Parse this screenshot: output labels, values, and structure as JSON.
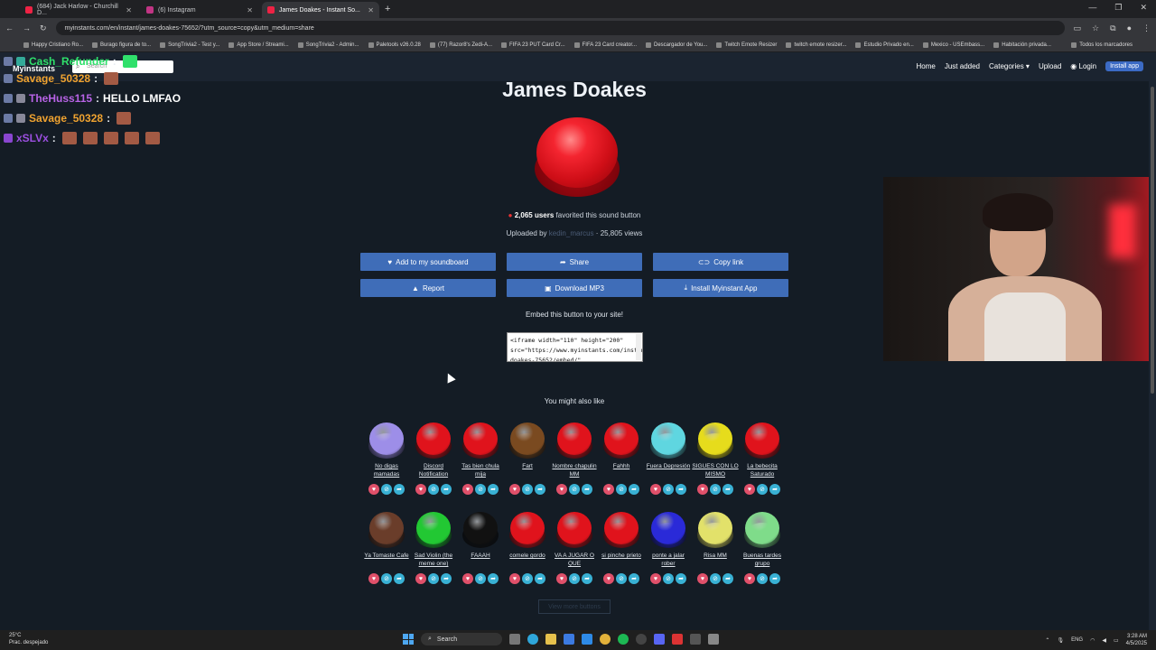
{
  "browser": {
    "tabs": [
      {
        "label": "(684) Jack Harlow - Churchill D...",
        "active": false
      },
      {
        "label": "(6) Instagram",
        "active": false
      },
      {
        "label": "James Doakes - Instant So...",
        "active": true
      }
    ],
    "url": "myinstants.com/en/instant/james-doakes-75652/?utm_source=copy&utm_medium=share",
    "bookmarks": [
      "Happy Cristiano Ro...",
      "Burago figura de to...",
      "SongTrivia2 - Test y...",
      "App Store / Streami...",
      "SongTrivia2 - Admin...",
      "Paletools v26.0.28",
      "(77) Razor8's Zedi-A...",
      "FIFA 23 PUT Card Cr...",
      "FIFA 23 Card creator...",
      "Descargador de You...",
      "Twitch Emote Resizer",
      "twitch emote resizer...",
      "Estudio Privado en...",
      "Mexico - USEmbass...",
      "Habitación privada..."
    ],
    "all_bookmarks": "Todos los marcadores"
  },
  "site": {
    "logo": "Myinstants",
    "search_placeholder": "Search",
    "nav": [
      "Home",
      "Just added",
      "Categories ▾",
      "Upload",
      "Login"
    ],
    "install_app": "Install app"
  },
  "chat": [
    {
      "user": "Cash_Refunder",
      "color": "#2fe06b",
      "message": ""
    },
    {
      "user": "Savage_50328",
      "color": "#f0a330",
      "message": ""
    },
    {
      "user": "TheHuss115",
      "color": "#b863e6",
      "message": "HELLO LMFAO"
    },
    {
      "user": "Savage_50328",
      "color": "#f0a330",
      "message": ""
    },
    {
      "user": "xSLVx",
      "color": "#9b4fe0",
      "message": ""
    }
  ],
  "sound": {
    "title": "James Doakes",
    "favorited_count": "2,065 users",
    "favorited_text": "favorited this sound button",
    "uploaded_by_label": "Uploaded by",
    "uploader": "kedin_marcus",
    "views": "25,805 views",
    "actions": {
      "add": "Add to my soundboard",
      "share": "Share",
      "copy": "Copy link",
      "report": "Report",
      "download": "Download MP3",
      "install": "Install Myinstant App"
    },
    "embed_label": "Embed this button to your site!",
    "embed_code": "<iframe width=\"110\" height=\"200\" src=\"https://www.myinstants.com/instant/james-doakes-75652/embed/\""
  },
  "suggestions_title": "You might also like",
  "suggestions": [
    {
      "label": "No digas mamadas",
      "color": "#9d8ee8"
    },
    {
      "label": "Discord Notification",
      "color": "#e0131c"
    },
    {
      "label": "Tas bien chula mija",
      "color": "#e0131c"
    },
    {
      "label": "Fart",
      "color": "#7a4a20"
    },
    {
      "label": "Nombre chapulin MM",
      "color": "#e0131c"
    },
    {
      "label": "Fahhh",
      "color": "#e0131c"
    },
    {
      "label": "Fuera Depresión",
      "color": "#5fd6e0"
    },
    {
      "label": "SIGUES CON LO MISMO",
      "color": "#e6dc1c"
    },
    {
      "label": "La bebecita Saturado",
      "color": "#e0131c"
    },
    {
      "label": "Ya Tomaste Cafe",
      "color": "#6a3d2a"
    },
    {
      "label": "Sad Violin (the meme one)",
      "color": "#22c833"
    },
    {
      "label": "FAAAH",
      "color": "#111111"
    },
    {
      "label": "comele gordo",
      "color": "#e0131c"
    },
    {
      "label": "VA A JUGAR O QUE",
      "color": "#e0131c"
    },
    {
      "label": "si pinche prieto",
      "color": "#e0131c"
    },
    {
      "label": "ponte a jalar rober",
      "color": "#2a2ad8"
    },
    {
      "label": "Risa MM",
      "color": "#e2e16a"
    },
    {
      "label": "Buenas tardes grupo",
      "color": "#7fdc8a"
    }
  ],
  "more_buttons": "View more buttons",
  "taskbar": {
    "weather_temp": "25°C",
    "weather_desc": "Prac. despejado",
    "search": "Search",
    "lang": "ENG",
    "time": "3:28 AM",
    "date": "4/5/2025"
  }
}
